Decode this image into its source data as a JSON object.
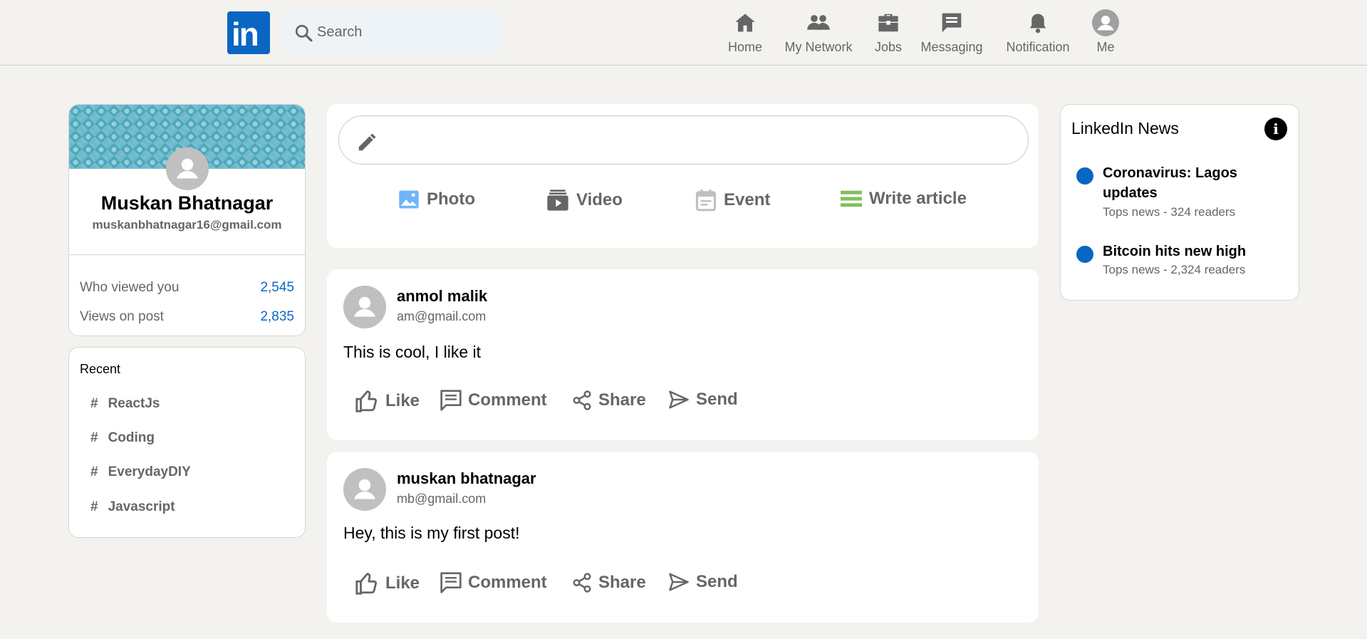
{
  "header": {
    "logo_text": "in",
    "search_placeholder": "Search",
    "nav": [
      {
        "label": "Home",
        "icon": "home-icon"
      },
      {
        "label": "My Network",
        "icon": "network-icon"
      },
      {
        "label": "Jobs",
        "icon": "briefcase-icon"
      },
      {
        "label": "Messaging",
        "icon": "message-icon"
      },
      {
        "label": "Notification",
        "icon": "bell-icon"
      },
      {
        "label": "Me",
        "icon": "avatar-icon"
      }
    ]
  },
  "profile": {
    "name": "Muskan Bhatnagar",
    "email": "muskanbhatnagar16@gmail.com",
    "stats": [
      {
        "label": "Who viewed you",
        "value": "2,545"
      },
      {
        "label": "Views on post",
        "value": "2,835"
      }
    ]
  },
  "recent": {
    "title": "Recent",
    "hash": "#",
    "items": [
      "ReactJs",
      "Coding",
      "EverydayDIY",
      "Javascript"
    ]
  },
  "composer": {
    "options": [
      {
        "label": "Photo",
        "color": "#70b5f9"
      },
      {
        "label": "Video",
        "color": "#666666"
      },
      {
        "label": "Event",
        "color": "#c0c0c0"
      },
      {
        "label": "Write article",
        "color": "#7fc15e"
      }
    ]
  },
  "posts": [
    {
      "name": "anmol malik",
      "email": "am@gmail.com",
      "message": "This is cool, I like it"
    },
    {
      "name": "muskan bhatnagar",
      "email": "mb@gmail.com",
      "message": "Hey, this is my first post!"
    }
  ],
  "post_actions": [
    "Like",
    "Comment",
    "Share",
    "Send"
  ],
  "news": {
    "title": "LinkedIn News",
    "info_glyph": "i",
    "items": [
      {
        "title": "Coronavirus: Lagos updates",
        "subtitle": "Tops news - 324 readers"
      },
      {
        "title": "Bitcoin hits new high",
        "subtitle": "Tops news - 2,324 readers"
      }
    ]
  },
  "colors": {
    "accent": "#0a66c2",
    "background": "#f3f2ef",
    "muted": "#666666"
  }
}
